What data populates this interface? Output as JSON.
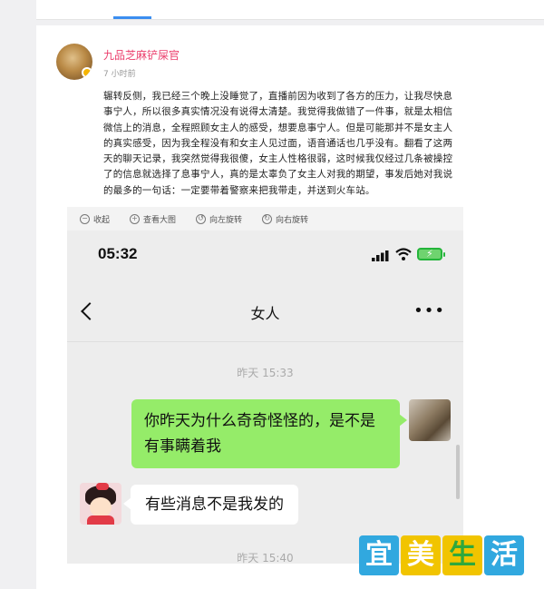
{
  "post": {
    "author": "九品芝麻铲屎官",
    "time": "7 小时前",
    "lines": [
      "辗转反侧，我已经三个晚上没睡觉了，直播前因为收到了各方的压力，让我尽快息",
      "事宁人，所以很多真实情况没有说得太清楚。我觉得我做错了一件事，就是太相信",
      "微信上的消息，全程照顾女主人的感受，想要息事宁人。但是可能那并不是女主人",
      "的真实感受，因为我全程没有和女主人见过面，语音通话也几乎没有。翻看了这两",
      "天的聊天记录，我突然觉得我很傻，女主人性格很弱，这时候我仅经过几条被操控",
      "了的信息就选择了息事宁人，真的是太辜负了女主人对我的期望，事发后她对我说",
      "的最多的一句话：一定要带着警察来把我带走，并送到火车站。"
    ],
    "collapse_label": "收起"
  },
  "viewer_toolbar": {
    "items": [
      {
        "icon": "collapse-icon",
        "label": "收起"
      },
      {
        "icon": "zoom-icon",
        "label": "查看大图"
      },
      {
        "icon": "rotate-left-icon",
        "label": "向左旋转"
      },
      {
        "icon": "rotate-right-icon",
        "label": "向右旋转"
      }
    ]
  },
  "phone": {
    "clock": "05:32",
    "chat_title": "女人",
    "more": "•••",
    "timestamp1": "昨天 15:33",
    "msg1": "你昨天为什么奇奇怪怪的，是不是有事瞒着我",
    "msg2": "有些消息不是我发的",
    "timestamp2": "昨天 15:40"
  },
  "watermark": [
    "宜",
    "美",
    "生",
    "活"
  ],
  "colors": {
    "author": "#eb3e6c",
    "link": "#3b7bd8",
    "bubble_me": "#95ec69",
    "accent_tab": "#3b8ef0"
  }
}
